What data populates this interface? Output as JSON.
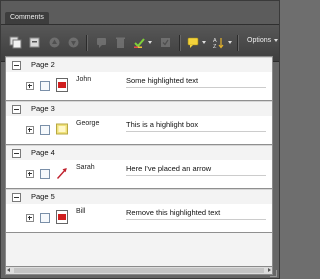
{
  "panel": {
    "tab_label": "Comments"
  },
  "toolbar": {
    "options_label": "Options",
    "buttons": [
      "expand-all-icon",
      "collapse-all-icon",
      "previous-comment-icon",
      "next-comment-icon",
      "reply-icon",
      "delete-icon",
      "checkmark-icon",
      "set-status-icon",
      "show-icon",
      "sort-icon"
    ]
  },
  "groups": [
    {
      "label": "Page 2",
      "comment": {
        "author": "John",
        "text": "Some highlighted text",
        "icon": "highlight-icon"
      }
    },
    {
      "label": "Page 3",
      "comment": {
        "author": "George",
        "text": "This is a highlight box",
        "icon": "highlight-box-icon"
      }
    },
    {
      "label": "Page 4",
      "comment": {
        "author": "Sarah",
        "text": "Here I've placed an arrow",
        "icon": "arrow-icon"
      }
    },
    {
      "label": "Page 5",
      "comment": {
        "author": "Bill",
        "text": "Remove this highlighted text",
        "icon": "highlight-icon"
      }
    }
  ],
  "colors": {
    "highlight_red": "#d01f1f",
    "highlight_yellow": "#f0e27a",
    "arrow_red": "#c0222e"
  }
}
